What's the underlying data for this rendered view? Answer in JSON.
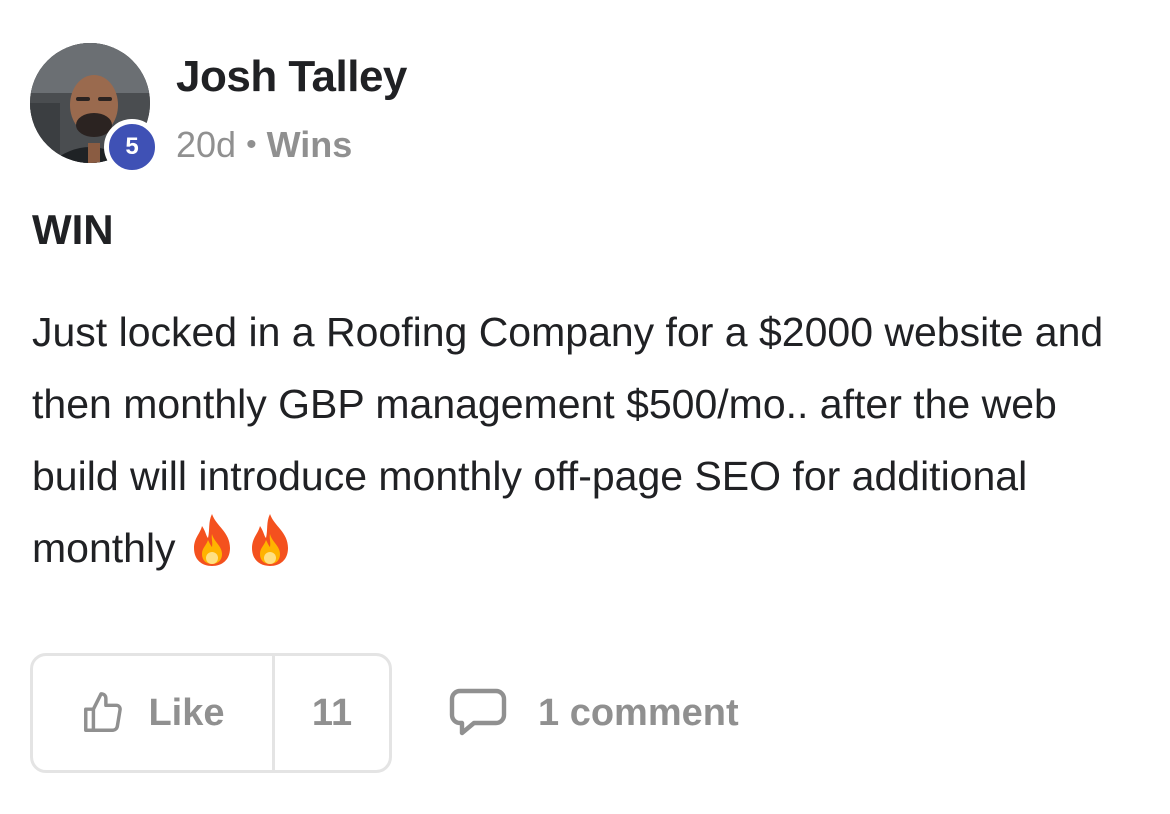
{
  "post": {
    "author": {
      "name": "Josh Talley",
      "level": "5"
    },
    "meta": {
      "time": "20d",
      "separator": "•",
      "category": "Wins"
    },
    "title": "WIN",
    "body": "Just locked in a Roofing Company for a $2000 website and then monthly GBP management $500/mo.. after the web build will introduce monthly off-page SEO for additional monthly",
    "body_emoji": [
      "fire-icon",
      "fire-icon"
    ],
    "actions": {
      "like_label": "Like",
      "like_count": "11",
      "comment_label": "1 comment"
    }
  },
  "colors": {
    "badge": "#3f51b5",
    "muted_text": "#909090",
    "border": "#e4e4e4",
    "text": "#202124"
  }
}
